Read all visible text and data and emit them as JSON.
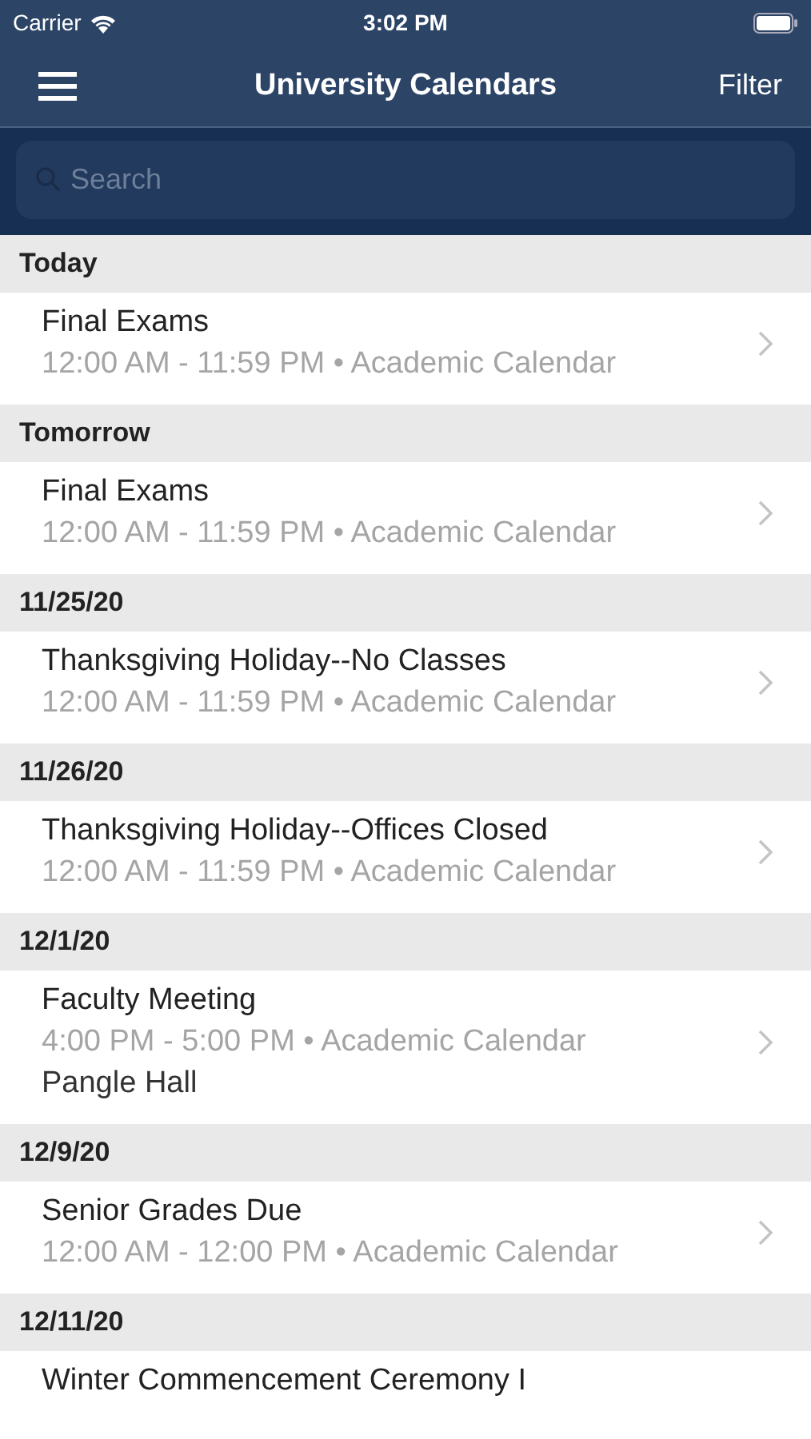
{
  "status_bar": {
    "carrier": "Carrier",
    "time": "3:02 PM"
  },
  "nav": {
    "title": "University Calendars",
    "filter": "Filter"
  },
  "search": {
    "placeholder": "Search"
  },
  "sections": [
    {
      "date": "Today",
      "events": [
        {
          "title": "Final Exams",
          "detail": "12:00 AM - 11:59 PM • Academic Calendar"
        }
      ]
    },
    {
      "date": "Tomorrow",
      "events": [
        {
          "title": "Final Exams",
          "detail": "12:00 AM - 11:59 PM • Academic Calendar"
        }
      ]
    },
    {
      "date": "11/25/20",
      "events": [
        {
          "title": "Thanksgiving Holiday--No Classes",
          "detail": "12:00 AM - 11:59 PM • Academic Calendar"
        }
      ]
    },
    {
      "date": "11/26/20",
      "events": [
        {
          "title": "Thanksgiving Holiday--Offices Closed",
          "detail": "12:00 AM - 11:59 PM • Academic Calendar"
        }
      ]
    },
    {
      "date": "12/1/20",
      "events": [
        {
          "title": "Faculty Meeting",
          "detail": "4:00 PM - 5:00 PM • Academic Calendar",
          "location": "Pangle Hall"
        }
      ]
    },
    {
      "date": "12/9/20",
      "events": [
        {
          "title": "Senior Grades Due",
          "detail": "12:00 AM - 12:00 PM • Academic Calendar"
        }
      ]
    },
    {
      "date": "12/11/20",
      "events": [
        {
          "title": "Winter Commencement Ceremony I"
        }
      ]
    }
  ]
}
